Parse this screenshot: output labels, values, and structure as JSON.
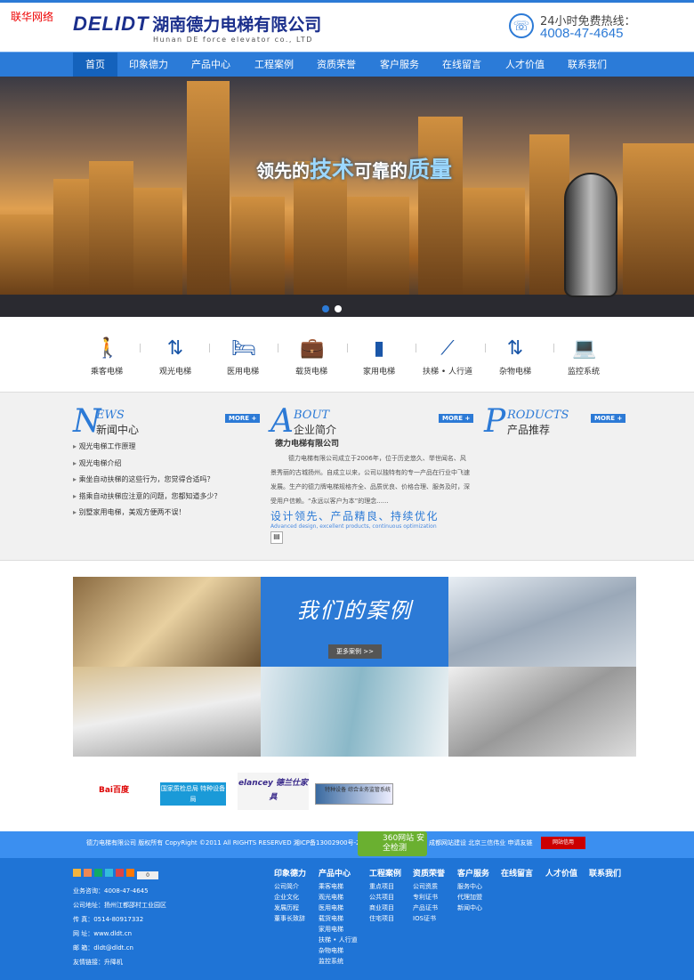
{
  "watermark": "联华网络",
  "header": {
    "logo_en": "DELIDT",
    "logo_cn": "湖南德力电梯有限公司",
    "logo_sub": "Hunan DE force elevator co., LTD",
    "hotline_label": "24小时免费热线：",
    "hotline": "4008-47-4645"
  },
  "nav": [
    "首页",
    "印象德力",
    "产品中心",
    "工程案例",
    "资质荣誉",
    "客户服务",
    "在线留言",
    "人才价值",
    "联系我们"
  ],
  "banner": {
    "slogan_a": "领先的",
    "slogan_b": "技术",
    "slogan_c": "可靠的",
    "slogan_d": "质量",
    "slides": 2,
    "active_slide": 1
  },
  "categories": [
    {
      "label": "乘客电梯",
      "icon": "passenger-icon"
    },
    {
      "label": "观光电梯",
      "icon": "sightseeing-icon"
    },
    {
      "label": "医用电梯",
      "icon": "bed-icon"
    },
    {
      "label": "载货电梯",
      "icon": "cargo-icon"
    },
    {
      "label": "家用电梯",
      "icon": "home-elevator-icon"
    },
    {
      "label": "扶梯 • 人行道",
      "icon": "escalator-icon"
    },
    {
      "label": "杂物电梯",
      "icon": "dumbwaiter-icon"
    },
    {
      "label": "监控系统",
      "icon": "monitor-icon"
    }
  ],
  "news": {
    "big": "N",
    "en": "EWS",
    "cn": "新闻中心",
    "more": "MORE +",
    "items": [
      "观光电梯工作原理",
      "观光电梯介绍",
      "乘坐自动扶梯的这些行为，您觉得合适吗？",
      "搭乘自动扶梯应注意的问题，您都知道多少？",
      "别墅家用电梯，美观方便两不误！"
    ]
  },
  "about": {
    "big": "A",
    "en": "BOUT",
    "cn": "企业简介",
    "more": "MORE +",
    "company": "德力电梯有限公司",
    "text": "德力电梯有限公司成立于2006年，位于历史悠久、举世闻名、风景秀丽的古城扬州。自成立以来，公司以独特有的专一产品在行业中飞速发展。生产的德力牌电梯规格齐全、品质优良、价格合理、服务及时，深受用户信赖。“永远以客户为本”的理念......",
    "slogan": "设计领先、产品精良、持续优化",
    "slogan_en": "Advanced design, excellent products, continuous optimization"
  },
  "products": {
    "big": "P",
    "en": "RODUCTS",
    "cn": "产品推荐",
    "more": "MORE +"
  },
  "cases": {
    "title": "我们的案例",
    "more": "更多案例 >>"
  },
  "partners": [
    "Bai百度",
    "国家质检总局 特种设备局",
    "elancey 德兰仕家具",
    "特种设备 综合业务监管系统"
  ],
  "copyright": {
    "text": "德力电梯有限公司 版权所有 CopyRight ©2011 All RIGHTS RESERVED 湘ICP备13002900号-2",
    "badge": "360网站 安全检测",
    "text2": "成都网站建设 北京三信伟业 申请友链",
    "credit": "网站信用"
  },
  "footer": {
    "share_count": "0",
    "info": [
      "业务咨询：4008-47-4645",
      "公司地址：扬州江都邵村工业园区",
      "传 真：0514-80917332",
      "网 址：www.dldt.cn",
      "邮 箱：dldt@dldt.cn",
      "友情链接：升降机"
    ],
    "columns": [
      {
        "title": "印象德力",
        "items": [
          "公司简介",
          "企业文化",
          "发展历程",
          "董事长致辞"
        ]
      },
      {
        "title": "产品中心",
        "items": [
          "乘客电梯",
          "观光电梯",
          "医用电梯",
          "载货电梯",
          "家用电梯",
          "扶梯 • 人行道",
          "杂物电梯",
          "监控系统"
        ]
      },
      {
        "title": "工程案例",
        "items": [
          "重点项目",
          "公共项目",
          "商业项目",
          "住宅项目"
        ]
      },
      {
        "title": "资质荣誉",
        "items": [
          "公司资质",
          "专利证书",
          "产品证书",
          "IOS证书"
        ]
      },
      {
        "title": "客户服务",
        "items": [
          "服务中心",
          "代理加盟",
          "新闻中心"
        ]
      },
      {
        "title": "在线留言",
        "items": []
      },
      {
        "title": "人才价值",
        "items": []
      },
      {
        "title": "联系我们",
        "items": []
      }
    ]
  }
}
